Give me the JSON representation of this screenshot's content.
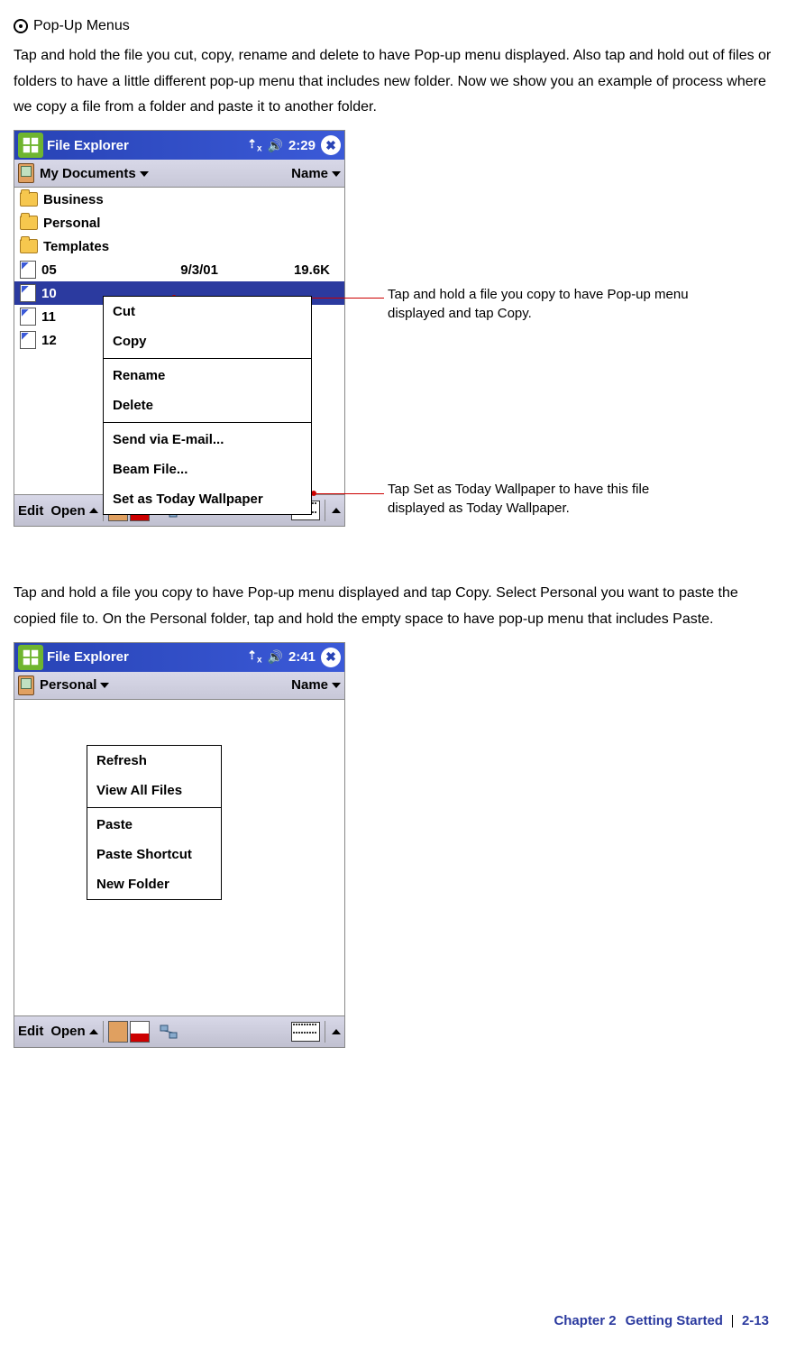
{
  "heading": "Pop-Up Menus",
  "para1": "Tap and hold the file you cut, copy, rename and delete to have Pop-up menu displayed. Also tap and hold out of files or folders to have a little different pop-up menu that includes new folder. Now we show you an example of process where we copy a file from a folder and paste it to another folder.",
  "para2": "Tap and hold a file you copy to have Pop-up menu displayed and tap Copy. Select Personal you want to paste the copied file to. On the Personal folder, tap and hold the empty space to have pop-up menu that includes Paste.",
  "screen1": {
    "title": "File Explorer",
    "time": "2:29",
    "location": "My Documents",
    "sort": "Name",
    "folders": [
      "Business",
      "Personal",
      "Templates"
    ],
    "files": [
      {
        "name": "05",
        "date": "9/3/01",
        "size": "19.6K"
      },
      {
        "name": "10",
        "date": "",
        "size": "",
        "selected": true
      },
      {
        "name": "11",
        "date": "",
        "size": ""
      },
      {
        "name": "12",
        "date": "",
        "size": ""
      }
    ],
    "popup": [
      "Cut",
      "Copy",
      "—",
      "Rename",
      "Delete",
      "—",
      "Send via E-mail...",
      "Beam File...",
      "Set as Today Wallpaper"
    ],
    "bottom_left1": "Edit",
    "bottom_left2": "Open"
  },
  "callout1": "Tap and hold a file you copy to have Pop-up menu displayed and tap Copy.",
  "callout2": "Tap Set as Today Wallpaper to have this file displayed as Today Wallpaper.",
  "screen2": {
    "title": "File Explorer",
    "time": "2:41",
    "location": "Personal",
    "sort": "Name",
    "popup": [
      "Refresh",
      "View All Files",
      "—",
      "Paste",
      "Paste Shortcut",
      "New Folder"
    ],
    "bottom_left1": "Edit",
    "bottom_left2": "Open"
  },
  "footer": {
    "chapter": "Chapter 2",
    "section": "Getting Started",
    "page": "2-13"
  }
}
